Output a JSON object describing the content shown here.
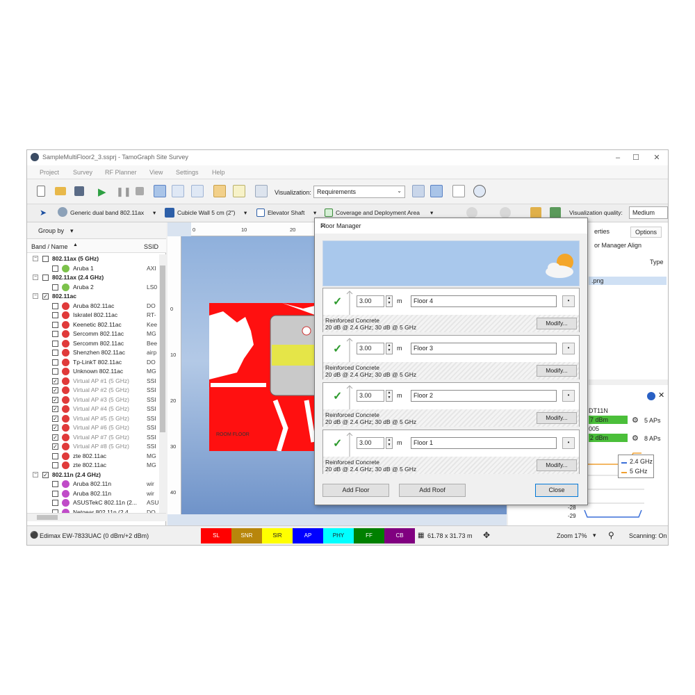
{
  "window": {
    "title": "SampleMultiFloor2_3.ssprj - TamoGraph Site Survey"
  },
  "menu": [
    "Project",
    "Survey",
    "RF Planner",
    "View",
    "Settings",
    "Help"
  ],
  "toolbar": {
    "visualization_label": "Visualization:",
    "visualization_value": "Requirements"
  },
  "toolbar2": {
    "ap_model": "Generic dual band 802.11ax",
    "wall_type": "Cubicle Wall 5 cm (2\")",
    "elevator": "Elevator Shaft",
    "coverage": "Coverage and Deployment Area",
    "quality_label": "Visualization quality:",
    "quality_value": "Medium"
  },
  "left_panel": {
    "group_by": "Group by",
    "col_band": "Band / Name",
    "col_ssid": "SSID",
    "rows": [
      {
        "label": "802.11ax (5 GHz)",
        "ssid": "",
        "group": true,
        "checked": false
      },
      {
        "label": "Aruba 1",
        "ssid": "AXI",
        "group": false,
        "checked": false,
        "color": "#7cc24b"
      },
      {
        "label": "802.11ax (2.4 GHz)",
        "ssid": "",
        "group": true,
        "checked": false
      },
      {
        "label": "Aruba 2",
        "ssid": "LS0",
        "group": false,
        "checked": false,
        "color": "#7cc24b"
      },
      {
        "label": "802.11ac",
        "ssid": "",
        "group": true,
        "checked": true
      },
      {
        "label": "Aruba 802.11ac",
        "ssid": "DO",
        "group": false,
        "checked": false,
        "color": "#e03a3a"
      },
      {
        "label": "Iskratel 802.11ac",
        "ssid": "RT-",
        "group": false,
        "checked": false,
        "color": "#e03a3a"
      },
      {
        "label": "Keenetic 802.11ac",
        "ssid": "Kee",
        "group": false,
        "checked": false,
        "color": "#e03a3a"
      },
      {
        "label": "Sercomm 802.11ac",
        "ssid": "MG",
        "group": false,
        "checked": false,
        "color": "#e03a3a"
      },
      {
        "label": "Sercomm 802.11ac",
        "ssid": "Bee",
        "group": false,
        "checked": false,
        "color": "#e03a3a"
      },
      {
        "label": "Shenzhen 802.11ac",
        "ssid": "airp",
        "group": false,
        "checked": false,
        "color": "#e03a3a"
      },
      {
        "label": "Tp-LinkT 802.11ac",
        "ssid": "DO",
        "group": false,
        "checked": false,
        "color": "#e03a3a"
      },
      {
        "label": "Unknown 802.11ac",
        "ssid": "MG",
        "group": false,
        "checked": false,
        "color": "#e03a3a"
      },
      {
        "label": "Virtual AP #1 (5 GHz)",
        "ssid": "SSI",
        "group": false,
        "checked": true,
        "color": "#e03a3a"
      },
      {
        "label": "Virtual AP #2 (5 GHz)",
        "ssid": "SSI",
        "group": false,
        "checked": true,
        "color": "#e03a3a"
      },
      {
        "label": "Virtual AP #3 (5 GHz)",
        "ssid": "SSI",
        "group": false,
        "checked": true,
        "color": "#e03a3a"
      },
      {
        "label": "Virtual AP #4 (5 GHz)",
        "ssid": "SSI",
        "group": false,
        "checked": true,
        "color": "#e03a3a"
      },
      {
        "label": "Virtual AP #5 (5 GHz)",
        "ssid": "SSI",
        "group": false,
        "checked": true,
        "color": "#e03a3a"
      },
      {
        "label": "Virtual AP #6 (5 GHz)",
        "ssid": "SSI",
        "group": false,
        "checked": true,
        "color": "#e03a3a"
      },
      {
        "label": "Virtual AP #7 (5 GHz)",
        "ssid": "SSI",
        "group": false,
        "checked": true,
        "color": "#e03a3a"
      },
      {
        "label": "Virtual AP #8 (5 GHz)",
        "ssid": "SSI",
        "group": false,
        "checked": true,
        "color": "#e03a3a"
      },
      {
        "label": "zte 802.11ac",
        "ssid": "MG",
        "group": false,
        "checked": false,
        "color": "#e03a3a"
      },
      {
        "label": "zte 802.11ac",
        "ssid": "MG",
        "group": false,
        "checked": false,
        "color": "#e03a3a"
      },
      {
        "label": "802.11n (2.4 GHz)",
        "ssid": "",
        "group": true,
        "checked": true
      },
      {
        "label": "Aruba 802.11n",
        "ssid": "wir",
        "group": false,
        "checked": false,
        "color": "#c04bc8"
      },
      {
        "label": "Aruba 802.11n",
        "ssid": "wir",
        "group": false,
        "checked": false,
        "color": "#c04bc8"
      },
      {
        "label": "ASUSTekC 802.11n (2...",
        "ssid": "ASU",
        "group": false,
        "checked": false,
        "color": "#c04bc8"
      },
      {
        "label": "Netgear 802.11n (2.4...",
        "ssid": "DO",
        "group": false,
        "checked": false,
        "color": "#c04bc8"
      }
    ]
  },
  "canvas": {
    "ruler_top": [
      "0",
      "10",
      "20"
    ],
    "ruler_left": [
      "0",
      "10",
      "20",
      "30",
      "40"
    ],
    "room_label": "ROOM FLOOR"
  },
  "right_panel": {
    "tabs": [
      "erties",
      "Options"
    ],
    "subtabs": [
      "or Manager",
      "Align"
    ],
    "col_type": "Type",
    "file": ".png",
    "ssid1": "DT11N",
    "sig1": "7 dBm",
    "aps1": "5 APs",
    "ssid2": "005",
    "sig2": "2 dBm",
    "aps2": "8 APs",
    "legend": [
      "2.4 GHz",
      "5 GHz"
    ],
    "y_ticks": [
      "-28",
      "-29"
    ],
    "band_colors": {
      "2.4 GHz": "#3a6fd8",
      "5 GHz": "#f0a030"
    }
  },
  "status": {
    "adapter": "Edimax EW-7833UAC (0 dBm/+2 dBm)",
    "legend": [
      {
        "label": "SL",
        "color": "#ff0000"
      },
      {
        "label": "SNR",
        "color": "#b8860b"
      },
      {
        "label": "SIR",
        "color": "#ffff00"
      },
      {
        "label": "AP",
        "color": "#0000ff"
      },
      {
        "label": "PHY",
        "color": "#00ffff"
      },
      {
        "label": "FF",
        "color": "#008000"
      },
      {
        "label": "CB",
        "color": "#800080"
      }
    ],
    "dimensions": "61.78 x 31.73 m",
    "zoom": "Zoom 17%",
    "scanning": "Scanning: On"
  },
  "dialog": {
    "title": "Floor Manager",
    "floors": [
      {
        "height": "3.00",
        "unit": "m",
        "name": "Floor 4",
        "material": "Reinforced Concrete",
        "atten": "20 dB @ 2.4 GHz; 30 dB @ 5 GHz",
        "modify": "Modify..."
      },
      {
        "height": "3.00",
        "unit": "m",
        "name": "Floor 3",
        "material": "Reinforced Concrete",
        "atten": "20 dB @ 2.4 GHz; 30 dB @ 5 GHz",
        "modify": "Modify..."
      },
      {
        "height": "3.00",
        "unit": "m",
        "name": "Floor 2",
        "material": "Reinforced Concrete",
        "atten": "20 dB @ 2.4 GHz; 30 dB @ 5 GHz",
        "modify": "Modify..."
      },
      {
        "height": "3.00",
        "unit": "m",
        "name": "Floor 1",
        "material": "Reinforced Concrete",
        "atten": "20 dB @ 2.4 GHz; 30 dB @ 5 GHz",
        "modify": "Modify..."
      }
    ],
    "add_floor": "Add Floor",
    "add_roof": "Add Roof",
    "close": "Close"
  }
}
